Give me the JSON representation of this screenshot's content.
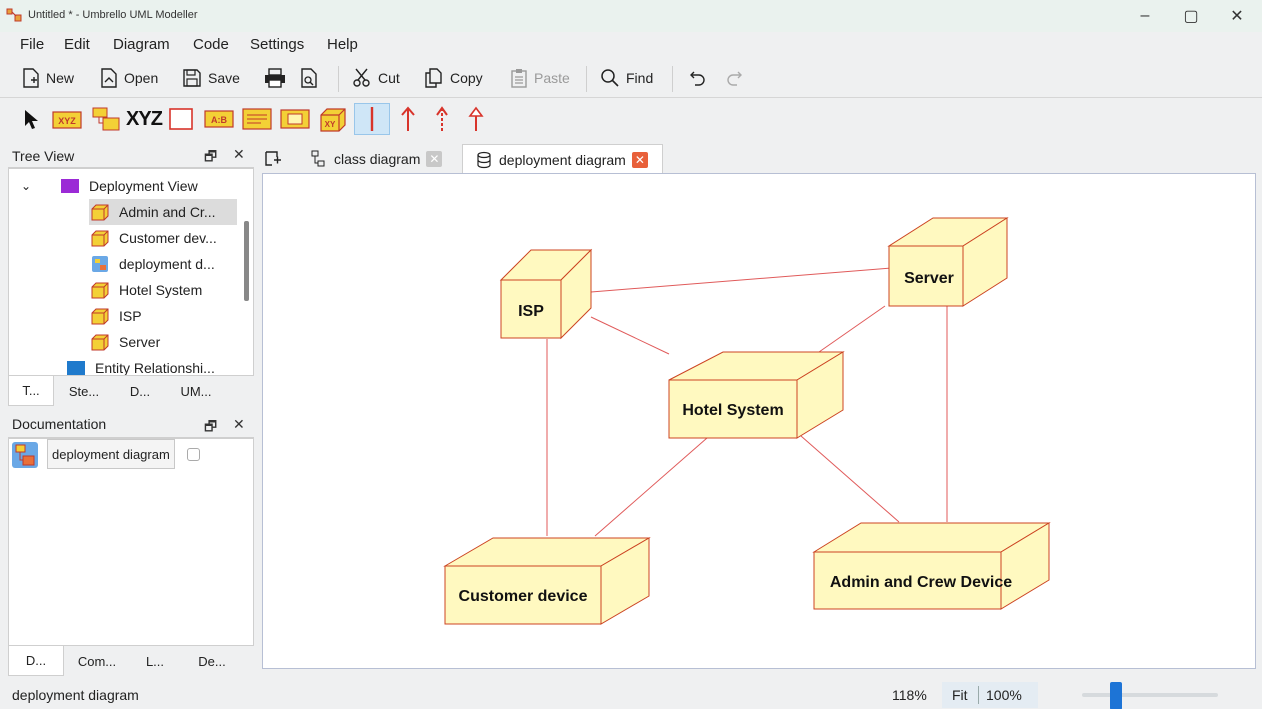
{
  "window": {
    "title": "Untitled * - Umbrello UML Modeller",
    "controls": {
      "minimize": "–",
      "maximize": "▢",
      "close": "✕"
    }
  },
  "menu": [
    "File",
    "Edit",
    "Diagram",
    "Code",
    "Settings",
    "Help"
  ],
  "toolbar": {
    "new": "New",
    "open": "Open",
    "save": "Save",
    "cut": "Cut",
    "copy": "Copy",
    "paste": "Paste",
    "find": "Find"
  },
  "toolbar2": {
    "xyz_label": "XYZ"
  },
  "tree_view": {
    "title": "Tree View",
    "items": [
      {
        "label": "Deployment View",
        "type": "folder"
      },
      {
        "label": "Admin and Cr...",
        "type": "node"
      },
      {
        "label": "Customer dev...",
        "type": "node"
      },
      {
        "label": "deployment d...",
        "type": "diagram"
      },
      {
        "label": "Hotel System",
        "type": "node"
      },
      {
        "label": "ISP",
        "type": "node"
      },
      {
        "label": "Server",
        "type": "node"
      },
      {
        "label": "Entity Relationshi...",
        "type": "folder"
      }
    ],
    "tabs": [
      "T...",
      "Ste...",
      "D...",
      "UM..."
    ]
  },
  "documentation": {
    "title": "Documentation",
    "item": "deployment diagram",
    "tabs": [
      "D...",
      "Com...",
      "L...",
      "De..."
    ]
  },
  "diagram_tabs": [
    {
      "label": "class diagram",
      "active": false
    },
    {
      "label": "deployment diagram",
      "active": true
    }
  ],
  "diagram": {
    "nodes": [
      {
        "id": "isp",
        "label": "ISP"
      },
      {
        "id": "server",
        "label": "Server"
      },
      {
        "id": "hotel",
        "label": "Hotel System"
      },
      {
        "id": "customer",
        "label": "Customer device"
      },
      {
        "id": "admin",
        "label": "Admin and Crew Device"
      }
    ],
    "colors": {
      "node_fill": "#fff9c0",
      "node_stroke": "#cc4422",
      "line": "#e05a5a"
    }
  },
  "status": {
    "text": "deployment diagram",
    "zoom": "118%",
    "fit": "Fit",
    "hundred": "100%"
  }
}
